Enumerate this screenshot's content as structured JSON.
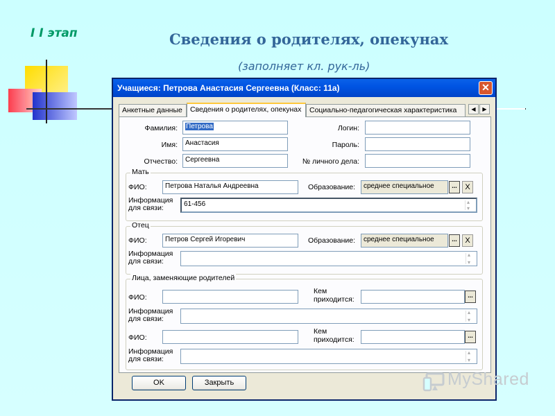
{
  "slide": {
    "stage_label": "I I этап",
    "title": "Сведения о родителях, опекунах",
    "subtitle": "(заполняет кл. рук-ль)"
  },
  "window": {
    "title": "Учащиеся: Петрова Анастасия Сергеевна (Класс: 11а)",
    "close_glyph": "✕"
  },
  "tabs": [
    {
      "label": "Анкетные данные",
      "active": false
    },
    {
      "label": "Сведения о родителях, опекунах",
      "active": true
    },
    {
      "label": "Социально-педагогическая характеристика",
      "active": false
    }
  ],
  "tab_scroll": {
    "left": "◀",
    "right": "▶"
  },
  "student": {
    "surname_label": "Фамилия:",
    "surname": "Петрова",
    "name_label": "Имя:",
    "name": "Анастасия",
    "patronymic_label": "Отчество:",
    "patronymic": "Сергеевна",
    "login_label": "Логин:",
    "login": "",
    "password_label": "Пароль:",
    "password": "",
    "file_no_label": "№ личного дела:",
    "file_no": ""
  },
  "mother": {
    "group_title": "Мать",
    "fio_label": "ФИО:",
    "fio": "Петрова Наталья Андреевна",
    "edu_label": "Образование:",
    "edu": "среднее специальное",
    "contact_label_1": "Информация",
    "contact_label_2": "для связи:",
    "contact": "61-456"
  },
  "father": {
    "group_title": "Отец",
    "fio_label": "ФИО:",
    "fio": "Петров Сергей Игоревич",
    "edu_label": "Образование:",
    "edu": "среднее специальное",
    "contact_label_1": "Информация",
    "contact_label_2": "для связи:",
    "contact": ""
  },
  "guardians": {
    "group_title": "Лица, заменяющие родителей",
    "fio_label": "ФИО:",
    "relation_label_1": "Кем",
    "relation_label_2": "приходится:",
    "contact_label_1": "Информация",
    "contact_label_2": "для связи:"
  },
  "buttons": {
    "dots": "...",
    "clear": "X",
    "ok": "OK",
    "close": "Закрыть"
  },
  "watermark": "MyShared"
}
